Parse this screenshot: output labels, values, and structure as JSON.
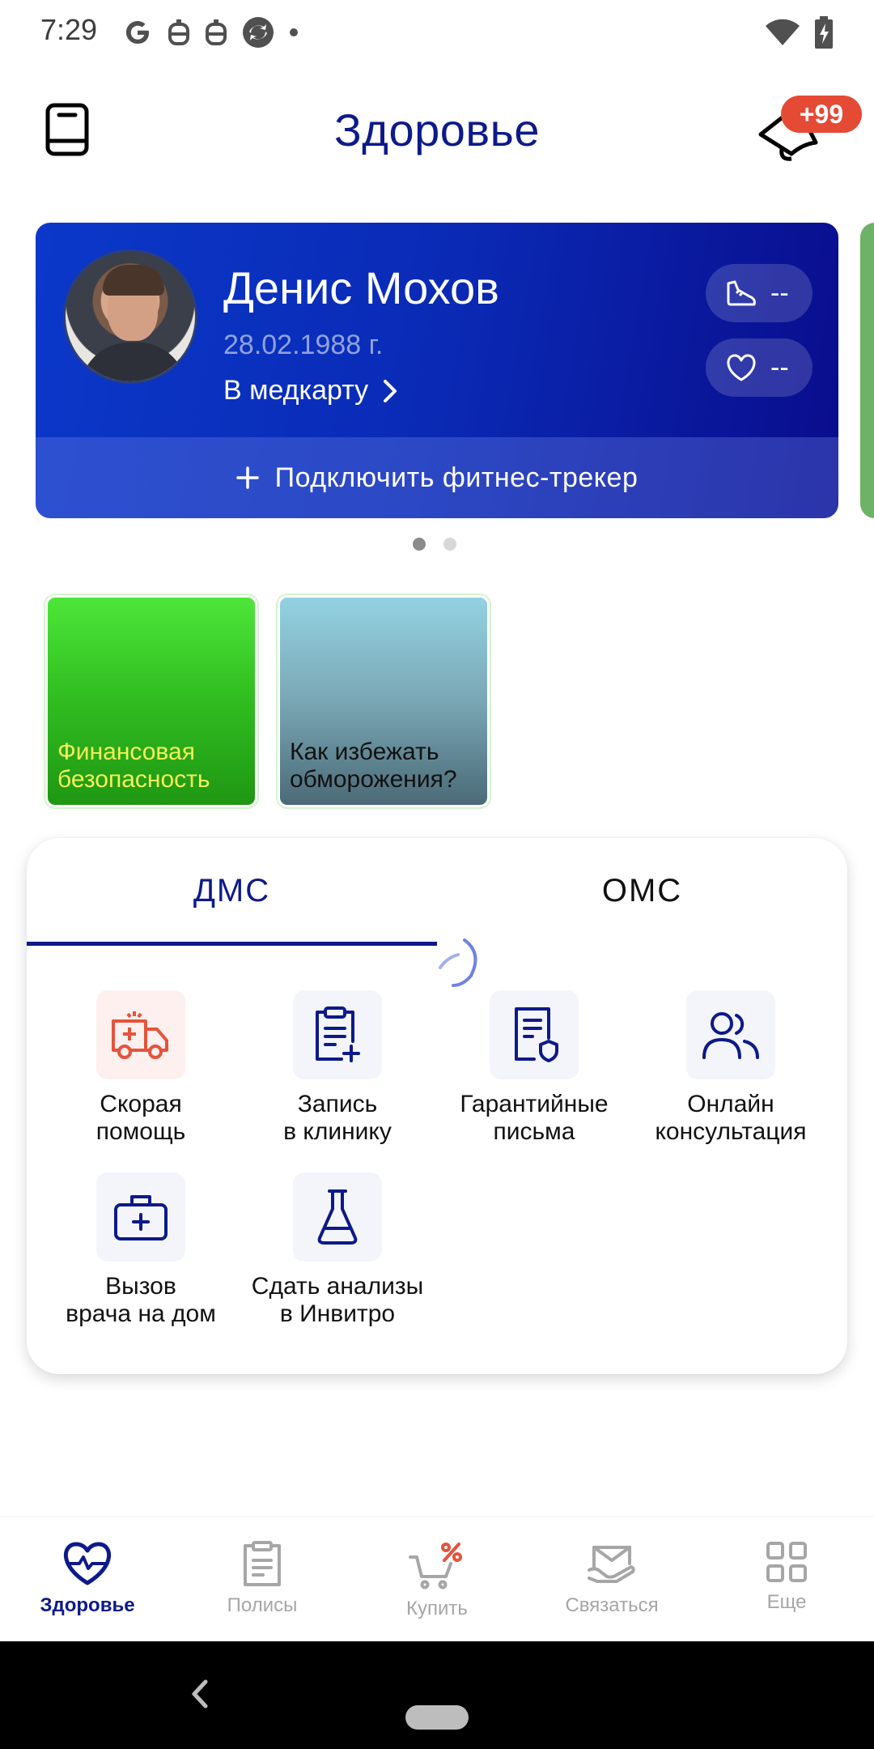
{
  "status_bar": {
    "time": "7:29",
    "left_icons": [
      "google-icon",
      "robot-icon",
      "robot-icon",
      "circle-arrows-icon",
      "dot-icon"
    ],
    "right_icons": [
      "wifi-icon",
      "battery-charging-icon"
    ]
  },
  "header": {
    "title": "Здоровье",
    "left_icon": "book-icon",
    "right_icon": "bell-icon",
    "notification_badge": "+99"
  },
  "profile": {
    "name": "Денис Мохов",
    "birth_date": "28.02.1988 г.",
    "medcard_link": "В медкарту",
    "steps_value": "--",
    "heart_value": "--",
    "connect_tracker": "Подключить фитнес-трекер",
    "pager": {
      "count": 2,
      "active": 1
    }
  },
  "stories": [
    {
      "label": "Финансовая безопасность",
      "color": "#32c022"
    },
    {
      "label": "Как избежать обморожения?",
      "color": "#7aa7b5"
    }
  ],
  "services": {
    "tabs": [
      {
        "label": "ДМС",
        "active": true
      },
      {
        "label": "ОМС",
        "active": false
      }
    ],
    "items": [
      {
        "label": "Скорая\nпомощь",
        "icon": "ambulance-icon"
      },
      {
        "label": "Запись\nв клинику",
        "icon": "clipboard-plus-icon"
      },
      {
        "label": "Гарантийные\nписьма",
        "icon": "document-shield-icon"
      },
      {
        "label": "Онлайн\nконсультация",
        "icon": "users-icon"
      },
      {
        "label": "Вызов\nврача на дом",
        "icon": "medical-bag-icon"
      },
      {
        "label": "Сдать анализы\nв Инвитро",
        "icon": "flask-icon"
      }
    ]
  },
  "bottom_nav": [
    {
      "label": "Здоровье",
      "icon": "heart-pulse-icon",
      "active": true
    },
    {
      "label": "Полисы",
      "icon": "clipboard-icon",
      "active": false
    },
    {
      "label": "Купить",
      "icon": "cart-percent-icon",
      "active": false
    },
    {
      "label": "Связаться",
      "icon": "mail-hand-icon",
      "active": false
    },
    {
      "label": "Еще",
      "icon": "grid-icon",
      "active": false
    }
  ],
  "colors": {
    "brand": "#0d1a8a",
    "card_start": "#0b38c9",
    "card_end": "#0a0c8c",
    "badge": "#e54a35",
    "ambulance": "#e5533c"
  }
}
